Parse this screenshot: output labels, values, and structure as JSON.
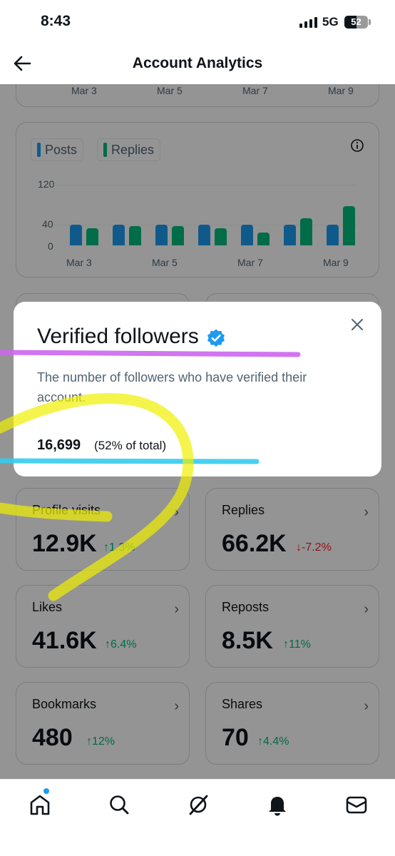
{
  "status": {
    "time": "8:43",
    "network": "5G",
    "battery": "52",
    "battery_level": 0.52
  },
  "header": {
    "title": "Account Analytics",
    "back_icon": "arrow-left-icon"
  },
  "top_chart_partial": {
    "ticks": [
      "Mar 3",
      "Mar 5",
      "Mar 7",
      "Mar 9"
    ]
  },
  "chart_data": {
    "type": "bar",
    "series": [
      {
        "name": "Posts",
        "color": "#1d9bf0",
        "values": [
          40,
          40,
          40,
          40,
          40,
          40,
          40
        ]
      },
      {
        "name": "Replies",
        "color": "#00ba7c",
        "values": [
          33,
          37,
          37,
          33,
          25,
          52,
          75
        ]
      }
    ],
    "categories": [
      "Mar 3",
      "Mar 4",
      "Mar 5",
      "Mar 6",
      "Mar 7",
      "Mar 8",
      "Mar 9"
    ],
    "xtick_labels": [
      "Mar 3",
      "Mar 5",
      "Mar 7",
      "Mar 9"
    ],
    "yticks": [
      "120",
      "40",
      "0"
    ],
    "ylim": [
      0,
      130
    ],
    "legend": "top-left"
  },
  "popup": {
    "title": "Verified followers",
    "description": "The number of followers who have verified their account.",
    "count": "16,699",
    "percent": "(52% of total)"
  },
  "metrics": [
    {
      "label": "Profile visits",
      "value": "12.9K",
      "delta": "↑1.3%",
      "trend": "up"
    },
    {
      "label": "Replies",
      "value": "66.2K",
      "delta": "↓-7.2%",
      "trend": "down"
    },
    {
      "label": "Likes",
      "value": "41.6K",
      "delta": "↑6.4%",
      "trend": "up"
    },
    {
      "label": "Reposts",
      "value": "8.5K",
      "delta": "↑11%",
      "trend": "up"
    },
    {
      "label": "Bookmarks",
      "value": "480",
      "delta": "↑12%",
      "trend": "up"
    },
    {
      "label": "Shares",
      "value": "70",
      "delta": "↑4.4%",
      "trend": "up"
    }
  ],
  "nav": [
    "home-icon",
    "search-icon",
    "grok-icon",
    "notifications-bell-icon",
    "messages-envelope-icon"
  ],
  "colors": {
    "accent": "#1d9bf0",
    "up": "#00ba7c",
    "down": "#f4212e",
    "highlight_purple": "#cc66ee",
    "highlight_cyan": "#33ccee",
    "highlight_yellow": "#f0f000"
  }
}
